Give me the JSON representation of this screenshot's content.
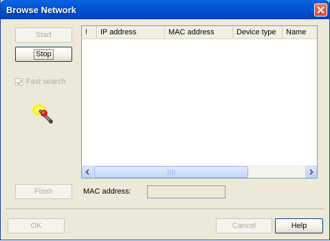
{
  "window": {
    "title": "Browse Network"
  },
  "buttons": {
    "start": "Start",
    "stop": "Stop",
    "flash": "Flash",
    "ok": "OK",
    "cancel": "Cancel",
    "help": "Help"
  },
  "options": {
    "fast_search_label": "Fast search",
    "fast_search_checked": true
  },
  "device_list": {
    "columns": [
      "!",
      "IP address",
      "MAC address",
      "Device type",
      "Name"
    ],
    "rows": []
  },
  "mac_address": {
    "label": "MAC address:",
    "value": ""
  },
  "icons": {
    "close": "close-icon",
    "searchlight": "searchlight-icon",
    "scroll_left": "chevron-left-icon",
    "scroll_right": "chevron-right-icon"
  },
  "colors": {
    "titlebar": "#0054e3",
    "dialog_background": "#ece9d8",
    "close_button": "#d85c3a"
  }
}
